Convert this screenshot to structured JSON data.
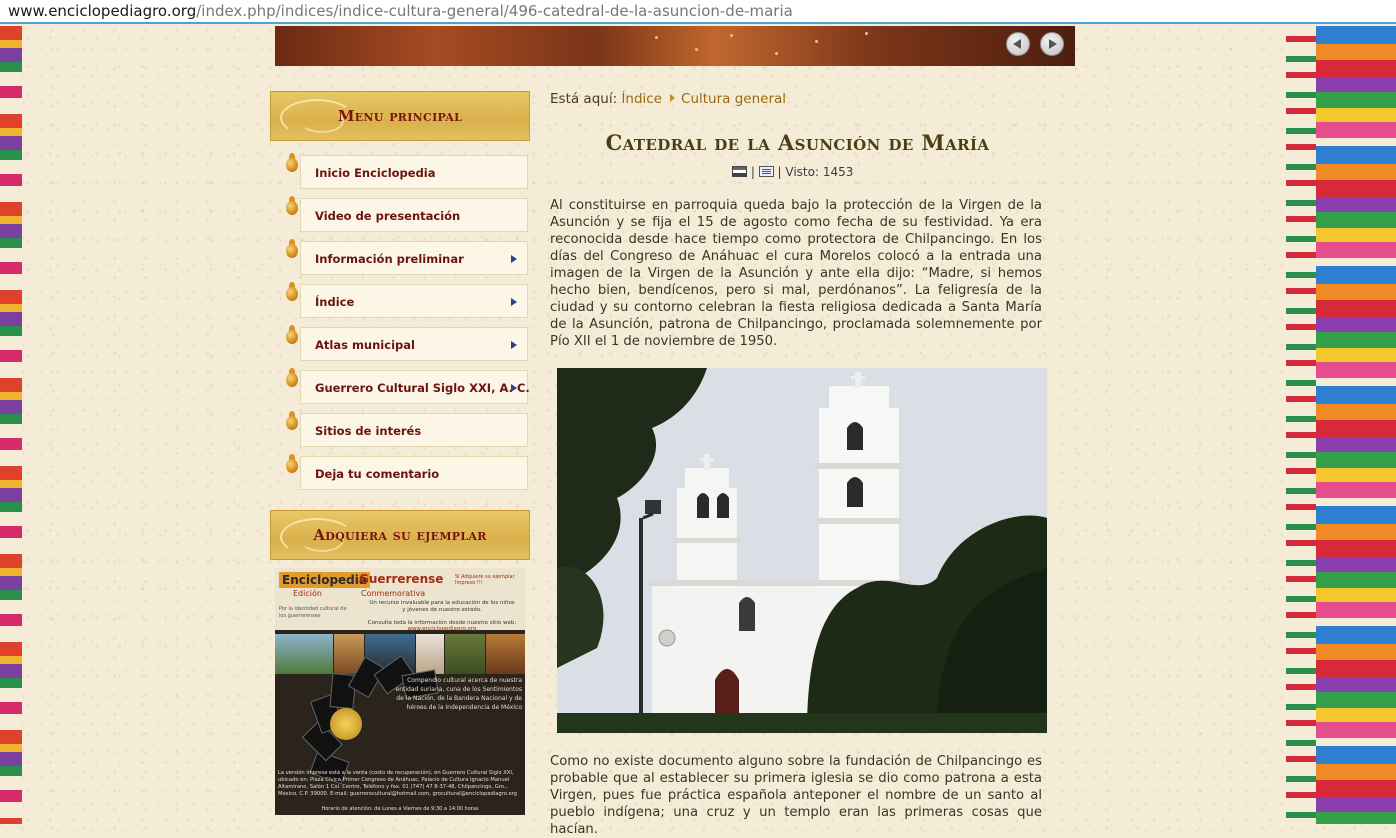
{
  "browser": {
    "url_host": "www.enciclopediagro.org",
    "url_path": "/index.php/indices/indice-cultura-general/496-catedral-de-la-asuncion-de-maria"
  },
  "colors": {
    "menu_text": "#6b1410",
    "header_gold": "#d9b14d",
    "link_gold": "#9a6a12",
    "title_olive": "#4a3e12",
    "submenu_arrow": "#2b3f8c"
  },
  "sidebar": {
    "main_menu_title": "Menu principal",
    "items": [
      {
        "label": "Inicio Enciclopedia",
        "has_submenu": false
      },
      {
        "label": "Video de presentación",
        "has_submenu": false
      },
      {
        "label": "Información preliminar",
        "has_submenu": true
      },
      {
        "label": "Índice",
        "has_submenu": true
      },
      {
        "label": "Atlas municipal",
        "has_submenu": true
      },
      {
        "label": "Guerrero Cultural Siglo XXI, A. C.",
        "has_submenu": true
      },
      {
        "label": "Sitios de interés",
        "has_submenu": false
      },
      {
        "label": "Deja tu comentario",
        "has_submenu": false
      }
    ],
    "buy_title": "Adquiera su ejemplar",
    "promo": {
      "title_a": "Enciclopedia",
      "title_b": "Guerrerense",
      "edition": "Edición",
      "commemorative": "Conmemorativa",
      "tagline": "Por la identidad cultural de los guerrerenses",
      "corner": "Si Adquiere su ejemplar Impreso !!!",
      "desc": "Un recurso invaluable para la educación de los niños y jóvenes de nuestro estado.",
      "consult": "Consulta toda la información desde nuestro sitio web:",
      "site": "www.enciclopediagro.org",
      "summary": "Compendio cultural acerca de nuestra entidad suriana, cuna de los Sentimientos de la Nación, de la Bandera Nacional y de héroes de la Independencia de México",
      "sale": "La versión impresa está a la venta (costo de recuperación), en Guerrero Cultural Siglo XXI, ubicado en: Plaza Cívica Primer Congreso de Anáhuac, Palacio de Cultura Ignacio Manuel Altamirano, Salón 1 Col. Centro, Teléfono y fax. 01 (747) 47 8-37-48, Chilpancingo, Gro., México, C.P. 39000. E-mail: guerrerocultural@hotmail.com, grocultural@enciclopediagro.org",
      "hours": "Horario de atención: de Lunes a Viernes de 9:30 a 14:00 horas"
    }
  },
  "breadcrumb": {
    "prefix": "Está aquí:",
    "items": [
      "Índice",
      "Cultura general"
    ]
  },
  "article": {
    "title": "Catedral de la Asunción de María",
    "sep": "|",
    "views": "| Visto: 1453",
    "paragraph1": "Al constituirse en parroquia queda bajo la protección de la Virgen de la Asunción y se fija el 15 de agosto como fecha de su festividad. Ya era reconocida desde hace tiempo como protectora de Chilpancingo. En los días del Congreso de Anáhuac el cura Morelos colocó a la entrada una imagen de la Virgen de la Asunción y ante ella dijo: “Madre, si hemos hecho bien, bendícenos, pero si mal, perdónanos”. La feligresía de la ciudad y su contorno celebran la fiesta religiosa dedicada a Santa María de la Asunción, patrona de Chilpancingo, proclamada solemnemente por Pío XII el 1 de noviembre de 1950.",
    "paragraph2": "Como no existe documento alguno sobre la fundación de Chilpancingo es probable que al establecer su primera iglesia se dio como patrona a esta Virgen, pues fue práctica española anteponer el nombre de un santo al pueblo indígena; una cruz y un templo eran las primeras cosas que hacían."
  },
  "icons": [
    "print-icon",
    "email-icon",
    "gourd-bullet-icon",
    "submenu-arrow-icon",
    "prev-arrow-icon",
    "next-arrow-icon"
  ]
}
